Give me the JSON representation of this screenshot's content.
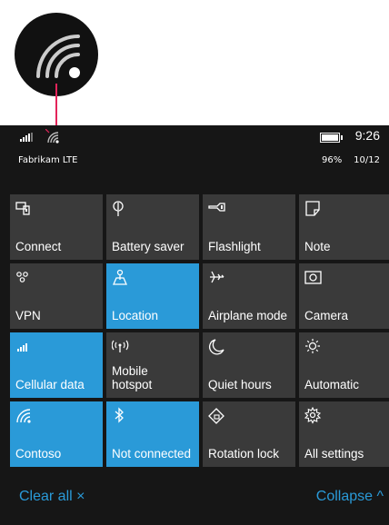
{
  "colors": {
    "accent": "#2a9ad8",
    "tile": "#3a3a3a",
    "background": "#161616",
    "callout_line": "#e3245a"
  },
  "callout": {
    "icon": "wifi-icon"
  },
  "status_bar": {
    "signal_icon": "cellular-signal-icon",
    "wifi_icon": "wifi-icon",
    "battery_icon": "battery-icon",
    "time": "9:26",
    "carrier": "Fabrikam LTE",
    "battery_percent": "96%",
    "date": "10/12"
  },
  "tiles": [
    {
      "label": "Connect",
      "icon": "connect-icon",
      "active": false
    },
    {
      "label": "Battery saver",
      "icon": "battery-saver-icon",
      "active": false
    },
    {
      "label": "Flashlight",
      "icon": "flashlight-icon",
      "active": false
    },
    {
      "label": "Note",
      "icon": "note-icon",
      "active": false
    },
    {
      "label": "VPN",
      "icon": "vpn-icon",
      "active": false
    },
    {
      "label": "Location",
      "icon": "location-icon",
      "active": true
    },
    {
      "label": "Airplane mode",
      "icon": "airplane-icon",
      "active": false
    },
    {
      "label": "Camera",
      "icon": "camera-icon",
      "active": false
    },
    {
      "label": "Cellular data",
      "icon": "cellular-data-icon",
      "active": true
    },
    {
      "label": "Mobile\nhotspot",
      "icon": "hotspot-icon",
      "active": false
    },
    {
      "label": "Quiet hours",
      "icon": "moon-icon",
      "active": false
    },
    {
      "label": "Automatic",
      "icon": "brightness-icon",
      "active": false
    },
    {
      "label": "Contoso",
      "icon": "wifi-icon",
      "active": true
    },
    {
      "label": "Not connected",
      "icon": "bluetooth-icon",
      "active": true
    },
    {
      "label": "Rotation lock",
      "icon": "rotation-lock-icon",
      "active": false
    },
    {
      "label": "All settings",
      "icon": "gear-icon",
      "active": false
    }
  ],
  "footer": {
    "clear_all": "Clear all ×",
    "collapse": "Collapse ^"
  }
}
